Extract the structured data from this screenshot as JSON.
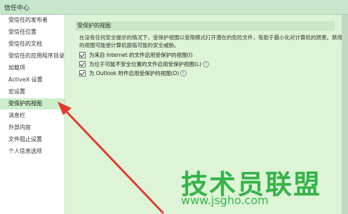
{
  "window": {
    "title": "信任中心"
  },
  "sidebar": {
    "items": [
      {
        "label": "受信任的发布者"
      },
      {
        "label": "受信任位置"
      },
      {
        "label": "受信任的文档"
      },
      {
        "label": "受信任的应用程序目录"
      },
      {
        "label": "加载项"
      },
      {
        "label": "ActiveX 设置"
      },
      {
        "label": "宏设置"
      },
      {
        "label": "受保护的视图",
        "selected": true
      },
      {
        "label": "消息栏"
      },
      {
        "label": "外部内容"
      },
      {
        "label": "文件阻止设置"
      },
      {
        "label": "个人信息选项"
      }
    ]
  },
  "main": {
    "section_title": "受保护的视图",
    "description_line1": "在没有任何安全提示的情况下，受保护视图以受限模式打开潜在的危险文件，有助于最小化对计算机的损害。禁用受保护",
    "description_line2": "的视图可能使计算机面临可能的安全威胁。",
    "options": [
      {
        "label": "为来自 Internet 的文件启用受保护的视图(I)",
        "checked": true,
        "has_info": false
      },
      {
        "label": "为位于可能不安全位置的文件启用受保护视图(L)",
        "checked": true,
        "has_info": true
      },
      {
        "label": "为 Outlook 附件启用受保护的视图(O)",
        "checked": true,
        "has_info": true
      }
    ]
  },
  "watermark": {
    "logo_text": "技术员联盟",
    "url": "www.jsgho.com"
  },
  "colors": {
    "annotation_arrow": "#e03a2f",
    "watermark": "#37b34a",
    "panel_bg": "#ddf4d7"
  }
}
